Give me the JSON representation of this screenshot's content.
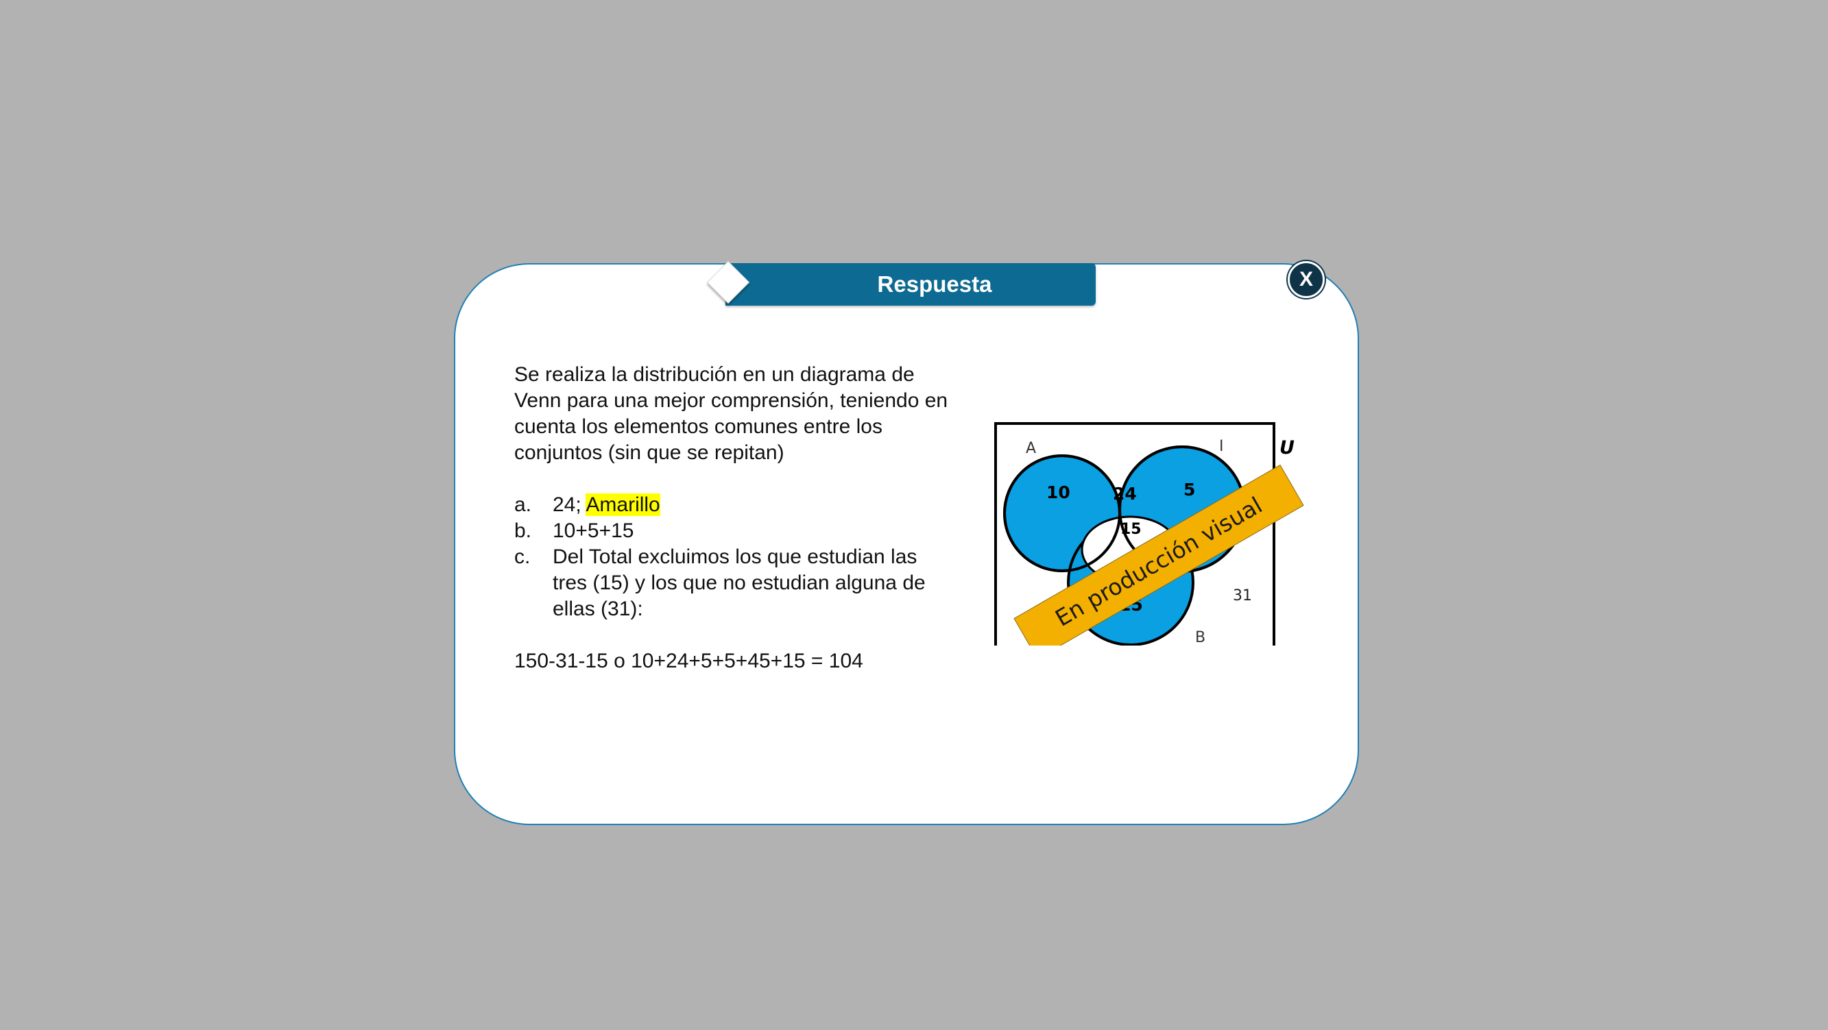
{
  "dialog": {
    "title": "Respuesta",
    "close_label": "X"
  },
  "content": {
    "intro": "Se realiza la distribución en un diagrama de Venn para una mejor comprensión, teniendo en cuenta los elementos comunes entre los conjuntos (sin que se repitan)",
    "items": [
      {
        "marker": "a.",
        "text_before": "24; ",
        "highlight": "Amarillo"
      },
      {
        "marker": "b.",
        "text": "10+5+15"
      },
      {
        "marker": "c.",
        "text": "Del Total excluimos los que estudian las tres (15) y los que no estudian alguna de ellas (31):"
      }
    ],
    "result": "150-31-15 o 10+24+5+5+45+15 = 104"
  },
  "venn": {
    "universe_label": "U",
    "sets": [
      "A",
      "I",
      "B"
    ],
    "regions": {
      "a_only": "10",
      "a_i": "24",
      "i_only": "5",
      "center": "15",
      "b_only": "15",
      "outside": "31"
    },
    "colors": {
      "set_fill": "#0aa0e2",
      "highlight_fill": "#ffff00",
      "banner_fill": "#f4b000"
    },
    "banner_text": "En producción visual"
  }
}
